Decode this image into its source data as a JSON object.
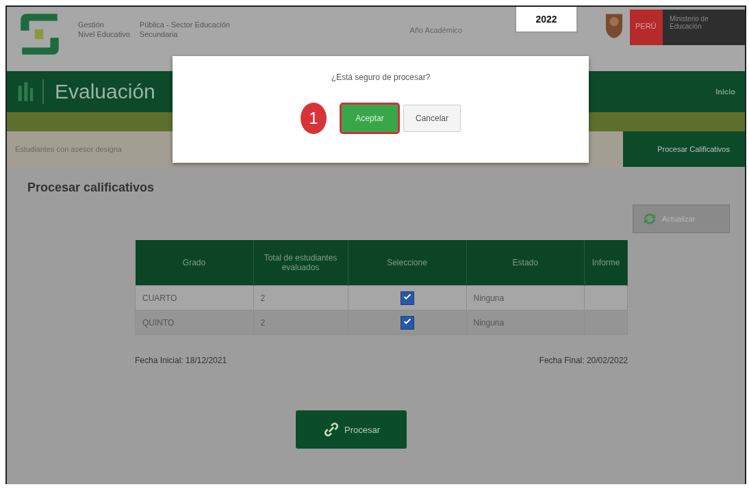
{
  "header": {
    "info": [
      {
        "label": "Gestión",
        "value": "Pública - Sector Educación"
      },
      {
        "label": "Nivel Educativo",
        "value": "Secundaria"
      }
    ],
    "year_label": "Año Académico",
    "year": "2022",
    "brand": {
      "country": "PERÚ",
      "ministry": "Ministerio de Educación"
    }
  },
  "app_bar": {
    "title": "Evaluación",
    "home": "Inicio"
  },
  "steps": [
    {
      "label": "Estudiantes con asesor designa",
      "selected": false
    },
    {
      "label": "Procesar Calificativos",
      "selected": true
    }
  ],
  "page_title": "Procesar calificativos",
  "refresh_button": "Actualizar",
  "table": {
    "columns": [
      "Grado",
      "Total de estudiantes evaluados",
      "Seleccione",
      "Estado",
      "Informe"
    ],
    "rows": [
      {
        "grade": "CUARTO",
        "total": "2",
        "checked": true,
        "status": "Ninguna"
      },
      {
        "grade": "QUINTO",
        "total": "2",
        "checked": true,
        "status": "Ninguna"
      }
    ]
  },
  "start_date": "Fecha Inicial: 18/12/2021",
  "end_date": "Fecha Final: 20/02/2022",
  "process_button": "Procesar",
  "dialog": {
    "message": "¿Está seguro de procesar?",
    "step_badge": "1",
    "buttons": [
      {
        "label": "Aceptar",
        "kind": "primary"
      },
      {
        "label": "Cancelar",
        "kind": "secondary"
      }
    ]
  }
}
